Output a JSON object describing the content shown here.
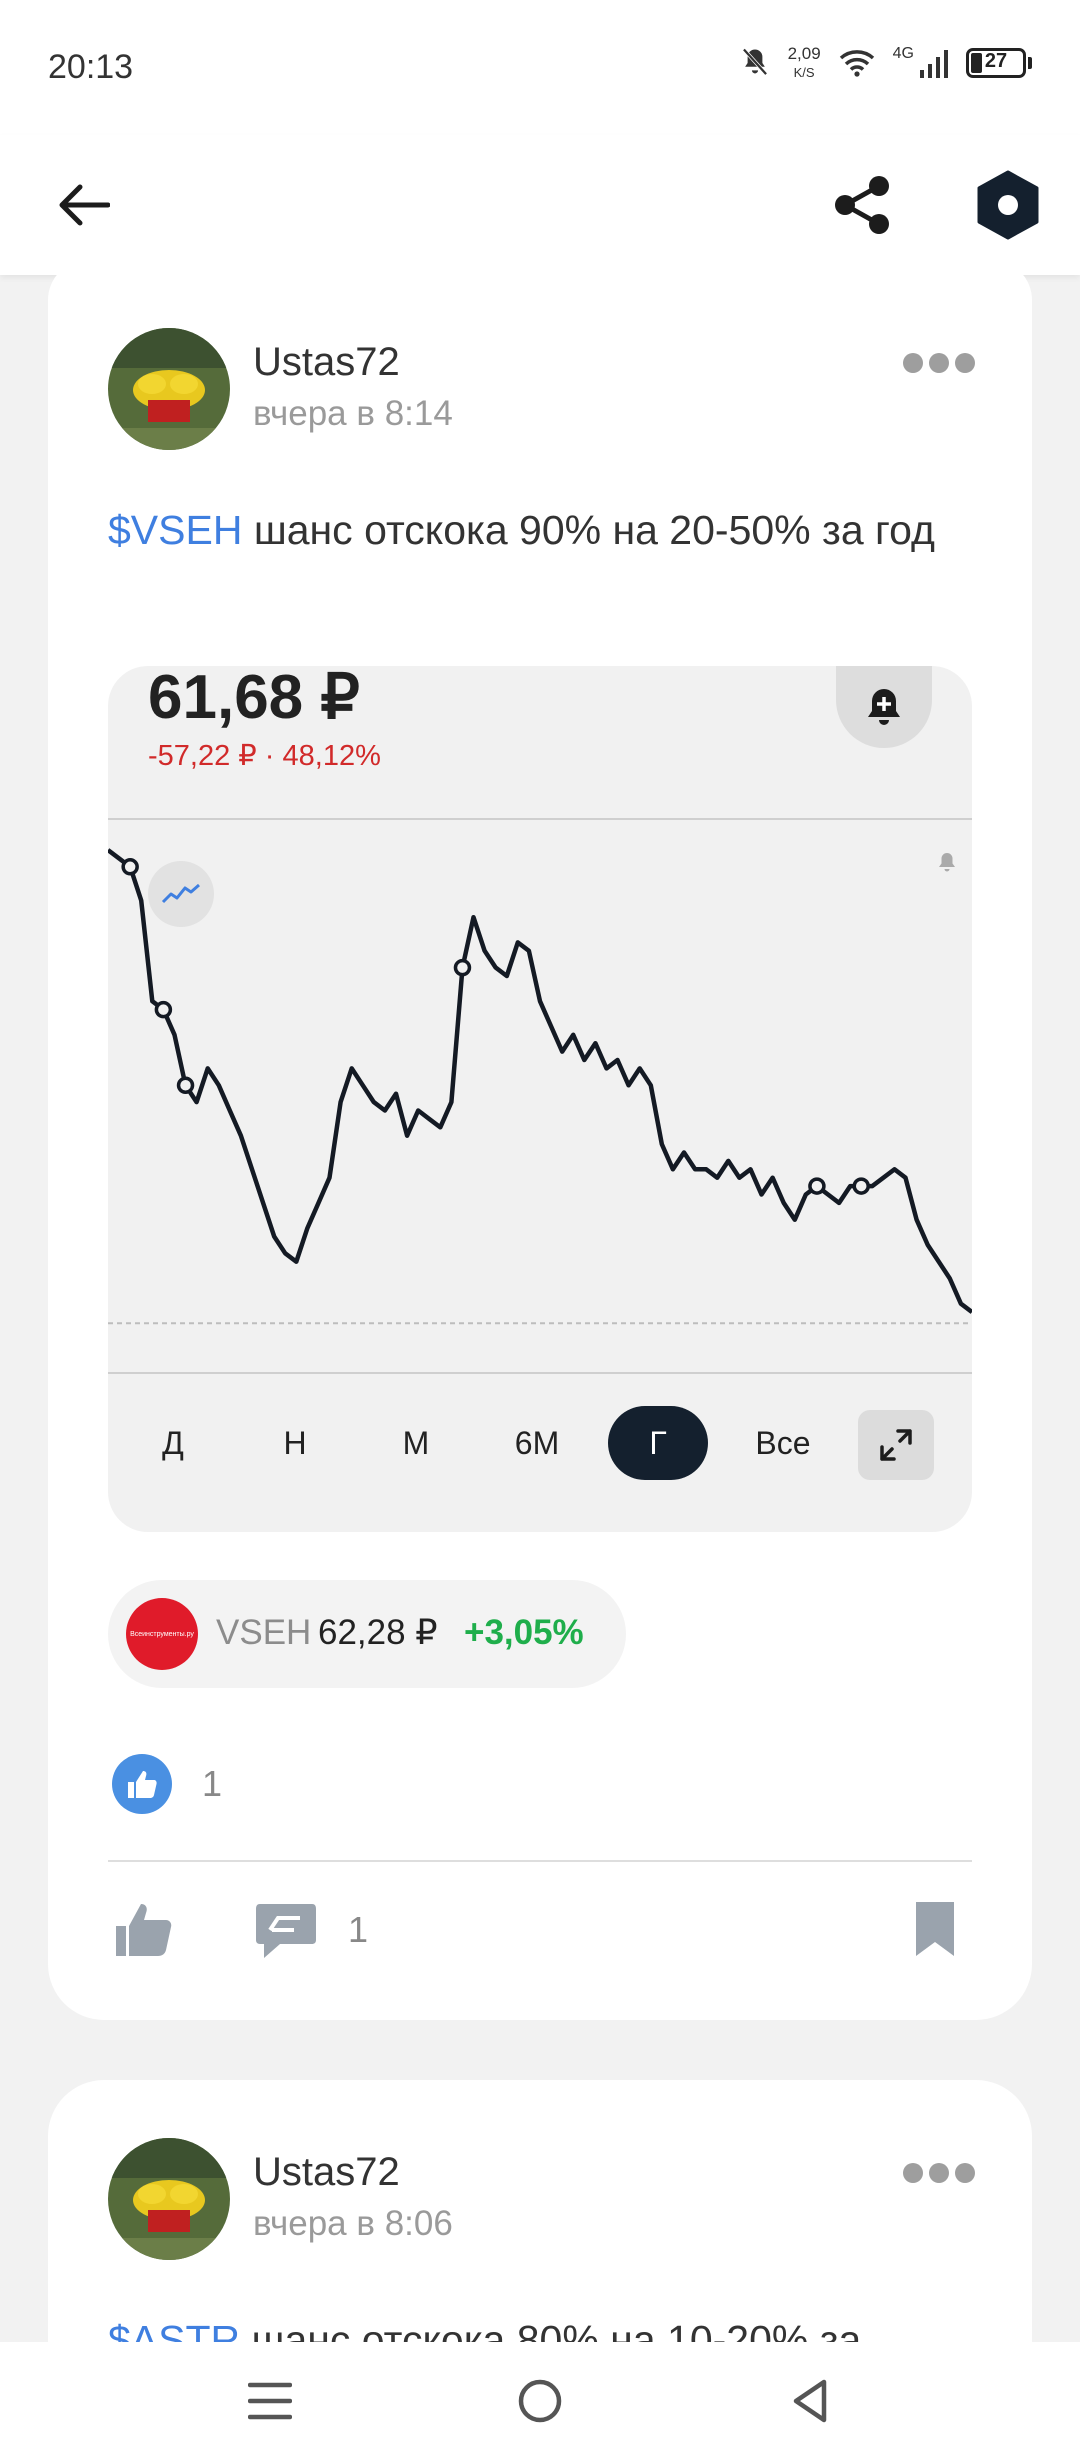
{
  "status_bar": {
    "time": "20:13",
    "net_speed_value": "2,09",
    "net_speed_unit": "K/S",
    "network_label": "4G",
    "battery_level": "27"
  },
  "top_bar": {
    "back_icon": "arrow-left-icon",
    "share_icon": "share-icon",
    "settings_icon": "hexagon-icon"
  },
  "posts": [
    {
      "author": "Ustas72",
      "time": "вчера в 8:14",
      "ticker": "$VSEH",
      "text": " шанс отскока 90% на 20-50% за год",
      "chart_widget": {
        "price": "61,68 ₽",
        "change": "-57,22 ₽ · 48,12%",
        "periods": [
          "Д",
          "Н",
          "М",
          "6М",
          "Г",
          "Все"
        ],
        "active_period": "Г"
      },
      "ticker_pill": {
        "logo_text": "Всеинструменты.ру",
        "ticker": "VSEH",
        "price": "62,28 ₽",
        "change": "+3,05%"
      },
      "likes": "1",
      "comments": "1"
    },
    {
      "author": "Ustas72",
      "time": "вчера в 8:06",
      "ticker": "$ASTR",
      "text": " шанс отскока 80% на 10-20% за"
    }
  ],
  "chart_data": {
    "type": "line",
    "title": "",
    "xlabel": "",
    "ylabel": "",
    "series": [
      {
        "values": [
          118,
          117,
          116,
          112,
          100,
          99,
          96,
          90,
          88,
          92,
          90,
          87,
          84,
          80,
          76,
          72,
          70,
          69,
          73,
          76,
          79,
          88,
          92,
          90,
          88,
          87,
          89,
          84,
          87,
          86,
          85,
          88,
          104,
          110,
          106,
          104,
          103,
          107,
          106,
          100,
          97,
          94,
          96,
          93,
          95,
          92,
          93,
          90,
          92,
          90,
          83,
          80,
          82,
          80,
          80,
          79,
          81,
          79,
          80,
          77,
          79,
          76,
          74,
          77,
          78,
          77,
          76,
          78,
          78,
          78,
          79,
          80,
          79,
          74,
          71,
          69,
          67,
          64,
          63
        ]
      }
    ],
    "reference_line": 61.68,
    "markers": "circles at selected points",
    "grid": false
  },
  "colors": {
    "accent": "#3f7fe0",
    "negative": "#d12a2a",
    "positive": "#1fae4b",
    "active_period_bg": "#14202e"
  }
}
